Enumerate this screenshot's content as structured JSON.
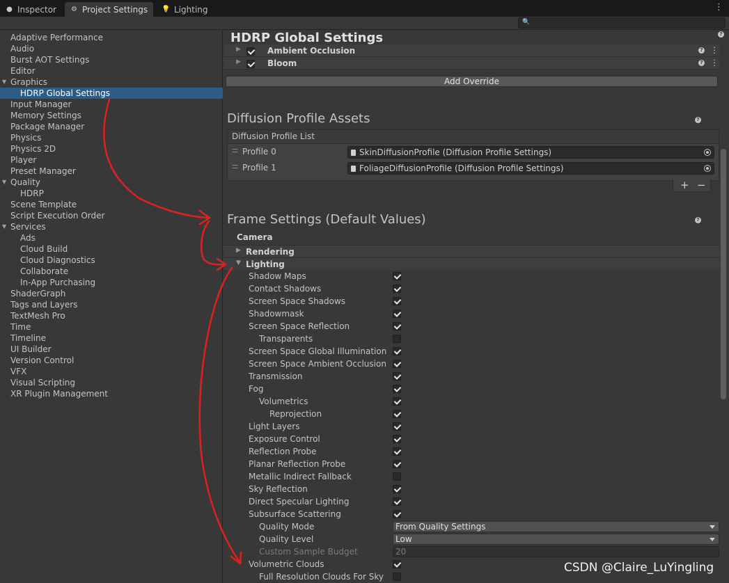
{
  "tabs": [
    {
      "label": "Inspector",
      "icon": "info-icon"
    },
    {
      "label": "Project Settings",
      "icon": "gear-icon"
    },
    {
      "label": "Lighting",
      "icon": "lightbulb-icon"
    }
  ],
  "sidebar": {
    "items": [
      {
        "label": "Adaptive Performance"
      },
      {
        "label": "Audio"
      },
      {
        "label": "Burst AOT Settings"
      },
      {
        "label": "Editor"
      },
      {
        "label": "Graphics",
        "expanded": true
      },
      {
        "label": "HDRP Global Settings",
        "selected": true
      },
      {
        "label": "Input Manager"
      },
      {
        "label": "Memory Settings"
      },
      {
        "label": "Package Manager"
      },
      {
        "label": "Physics"
      },
      {
        "label": "Physics 2D"
      },
      {
        "label": "Player"
      },
      {
        "label": "Preset Manager"
      },
      {
        "label": "Quality",
        "expanded": true
      },
      {
        "label": "HDRP"
      },
      {
        "label": "Scene Template"
      },
      {
        "label": "Script Execution Order"
      },
      {
        "label": "Services",
        "expanded": true
      },
      {
        "label": "Ads"
      },
      {
        "label": "Cloud Build"
      },
      {
        "label": "Cloud Diagnostics"
      },
      {
        "label": "Collaborate"
      },
      {
        "label": "In-App Purchasing"
      },
      {
        "label": "ShaderGraph"
      },
      {
        "label": "Tags and Layers"
      },
      {
        "label": "TextMesh Pro"
      },
      {
        "label": "Time"
      },
      {
        "label": "Timeline"
      },
      {
        "label": "UI Builder"
      },
      {
        "label": "Version Control"
      },
      {
        "label": "VFX"
      },
      {
        "label": "Visual Scripting"
      },
      {
        "label": "XR Plugin Management"
      }
    ]
  },
  "main": {
    "title": "HDRP Global Settings",
    "volume_overrides": [
      {
        "label": "Ambient Occlusion",
        "enabled": true
      },
      {
        "label": "Bloom",
        "enabled": true
      }
    ],
    "add_override_label": "Add Override",
    "diffusion": {
      "title": "Diffusion Profile Assets",
      "list_label": "Diffusion Profile List",
      "profiles": [
        {
          "name": "Profile 0",
          "value": "SkinDiffusionProfile (Diffusion Profile Settings)"
        },
        {
          "name": "Profile 1",
          "value": "FoliageDiffusionProfile (Diffusion Profile Settings)"
        }
      ],
      "add_symbol": "+",
      "remove_symbol": "−"
    },
    "frame_settings": {
      "title": "Frame Settings (Default Values)",
      "category": "Camera",
      "rendering_label": "Rendering",
      "lighting_label": "Lighting",
      "rows": [
        {
          "label": "Shadow Maps",
          "checked": true
        },
        {
          "label": "Contact Shadows",
          "checked": true
        },
        {
          "label": "Screen Space Shadows",
          "checked": true
        },
        {
          "label": "Shadowmask",
          "checked": true
        },
        {
          "label": "Screen Space Reflection",
          "checked": true
        },
        {
          "label": "Transparents",
          "checked": false
        },
        {
          "label": "Screen Space Global Illumination",
          "checked": true
        },
        {
          "label": "Screen Space Ambient Occlusion",
          "checked": true
        },
        {
          "label": "Transmission",
          "checked": true
        },
        {
          "label": "Fog",
          "checked": true
        },
        {
          "label": "Volumetrics",
          "checked": true
        },
        {
          "label": "Reprojection",
          "checked": true
        },
        {
          "label": "Light Layers",
          "checked": true
        },
        {
          "label": "Exposure Control",
          "checked": true
        },
        {
          "label": "Reflection Probe",
          "checked": true
        },
        {
          "label": "Planar Reflection Probe",
          "checked": true
        },
        {
          "label": "Metallic Indirect Fallback",
          "checked": false
        },
        {
          "label": "Sky Reflection",
          "checked": true
        },
        {
          "label": "Direct Specular Lighting",
          "checked": true
        },
        {
          "label": "Subsurface Scattering",
          "checked": true
        },
        {
          "label": "Quality Mode",
          "value": "From Quality Settings"
        },
        {
          "label": "Quality Level",
          "value": "Low"
        },
        {
          "label": "Custom Sample Budget",
          "value": "20"
        },
        {
          "label": "Volumetric Clouds",
          "checked": true
        },
        {
          "label": "Full Resolution Clouds For Sky",
          "checked": false
        }
      ]
    }
  },
  "watermark": "CSDN @Claire_LuYingling",
  "colors": {
    "selection": "#2c5d87",
    "background": "#383838",
    "annotation_arrow": "#e02020"
  }
}
